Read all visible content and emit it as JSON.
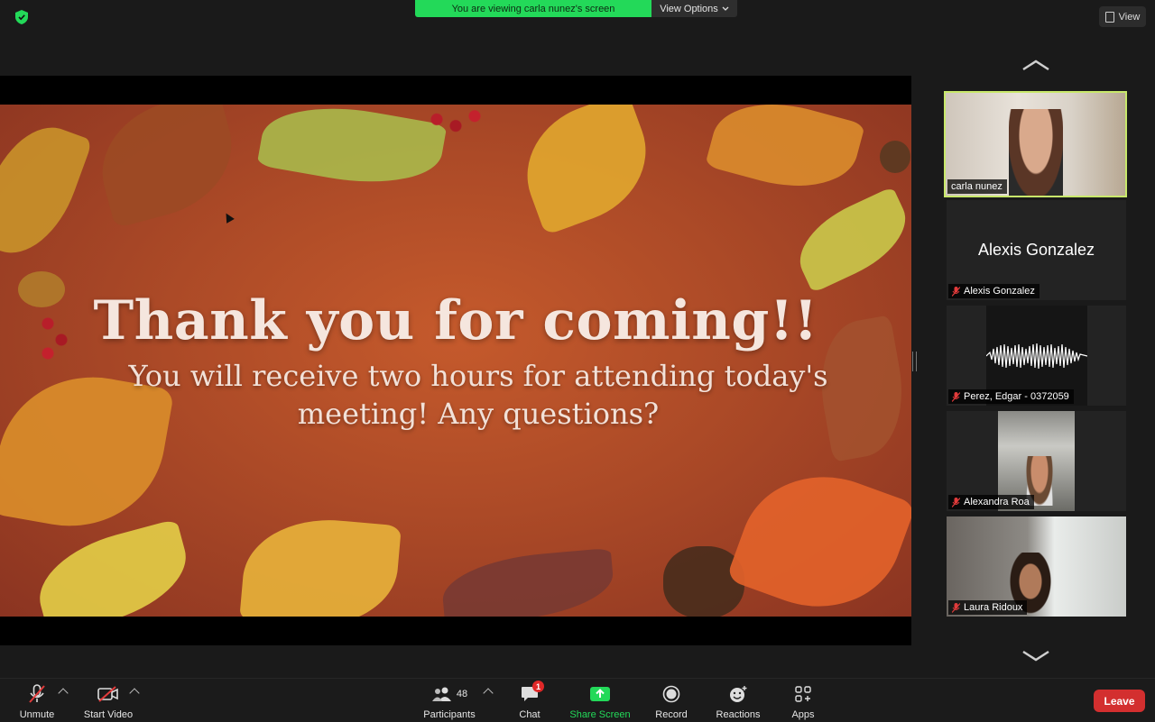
{
  "top": {
    "banner": "You are viewing carla nunez's screen",
    "view_options": "View Options",
    "view": "View"
  },
  "slide": {
    "title": "Thank you for coming!!",
    "subtitle": "You will receive two hours for attending today's meeting! Any questions?"
  },
  "participants_panel": [
    {
      "name": "carla nunez",
      "muted": false,
      "active_speaker": true,
      "video": true
    },
    {
      "name": "Alexis Gonzalez",
      "display": "Alexis Gonzalez",
      "muted": true,
      "video": false
    },
    {
      "name": "Perez, Edgar - 0372059",
      "muted": true,
      "video": "audio-wave"
    },
    {
      "name": "Alexandra Roa",
      "muted": true,
      "video": true
    },
    {
      "name": "Laura Ridoux",
      "muted": true,
      "video": true
    }
  ],
  "toolbar": {
    "unmute": "Unmute",
    "start_video": "Start Video",
    "participants": "Participants",
    "participants_count": "48",
    "chat": "Chat",
    "chat_badge": "1",
    "share_screen": "Share Screen",
    "record": "Record",
    "reactions": "Reactions",
    "apps": "Apps",
    "leave": "Leave"
  },
  "colors": {
    "banner_green": "#23d959",
    "active_border": "#c8e86a",
    "leave_red": "#d32f2f"
  }
}
